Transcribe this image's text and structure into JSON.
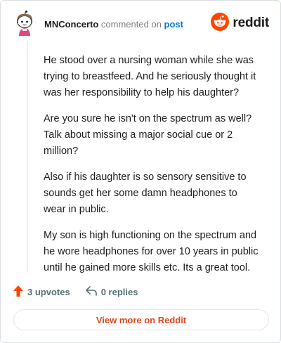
{
  "header": {
    "username": "MNConcerto",
    "action_text": "commented on",
    "post_link": "post",
    "brand_word": "reddit"
  },
  "comment": {
    "paragraphs": [
      "He stood over a nursing woman while she was trying to breastfeed. And he seriously thought it was her responsibility to help his daughter?",
      "Are you sure he isn't on the spectrum as well? Talk about missing a major social cue or 2 million?",
      "Also if his daughter is so sensory sensitive to sounds get her some damn headphones to wear in public.",
      "My son is high functioning on the spectrum and he wore headphones for over 10 years in public until he gained more skills etc. Its a great tool."
    ]
  },
  "actions": {
    "upvotes": "3 upvotes",
    "replies": "0 replies"
  },
  "footer": {
    "view_more": "View more on Reddit"
  },
  "colors": {
    "brand": "#ff4500",
    "link": "#0079d3",
    "button_text": "#e0471f",
    "muted": "#576f76"
  },
  "icons": {
    "avatar": "user-avatar",
    "brand": "reddit-snoo-icon",
    "upvote": "upvote-arrow-icon",
    "reply": "reply-arrow-icon"
  }
}
